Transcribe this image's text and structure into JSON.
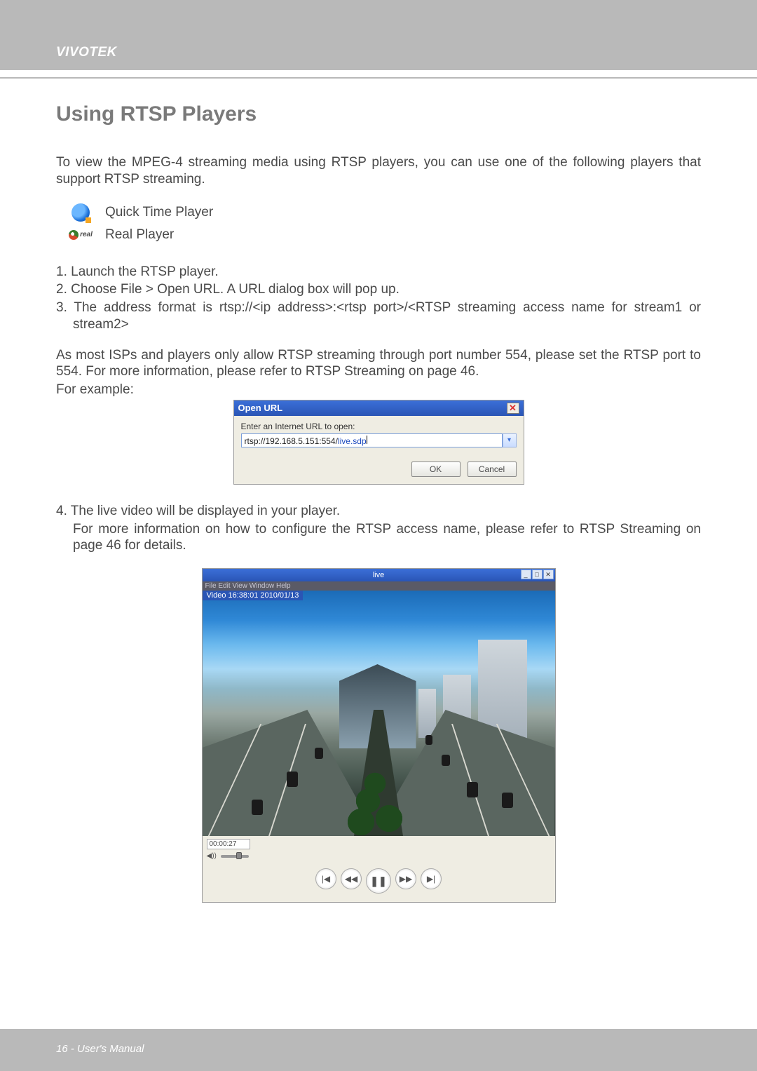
{
  "brand": "VIVOTEK",
  "section_title": "Using RTSP Players",
  "intro": "To view the MPEG-4 streaming media using RTSP players, you can use one of the following players that support RTSP streaming.",
  "players": {
    "quicktime_label": "Quick Time Player",
    "quicktime_sub": "",
    "real_label": "Real Player",
    "real_mark": "real"
  },
  "steps": {
    "s1": "1. Launch the RTSP player.",
    "s2": "2. Choose File > Open URL. A URL dialog box will pop up.",
    "s3": "3. The address format is rtsp://<ip address>:<rtsp port>/<RTSP streaming access name for stream1 or stream2>",
    "s4a": "4. The live video will be displayed in your player.",
    "s4b": "For more information on how to configure the RTSP access name, please refer to RTSP Streaming on page 46 for details."
  },
  "note": "As most ISPs and players only allow RTSP streaming through port number 554, please set the RTSP port to 554. For more information, please refer to RTSP Streaming on page 46.",
  "example_label": "For example:",
  "open_url": {
    "title": "Open URL",
    "label": "Enter an Internet URL to open:",
    "value_pre": "rtsp://192.168.5.151:554/",
    "value_post": "live.sdp",
    "ok": "OK",
    "cancel": "Cancel"
  },
  "player_shot": {
    "title": "live",
    "menu": "File  Edit  View  Window  Help",
    "overlay": "Video 16:38:01 2010/01/13",
    "time": "00:00:27",
    "vol_label": "◀))"
  },
  "footer": "16 - User's Manual"
}
